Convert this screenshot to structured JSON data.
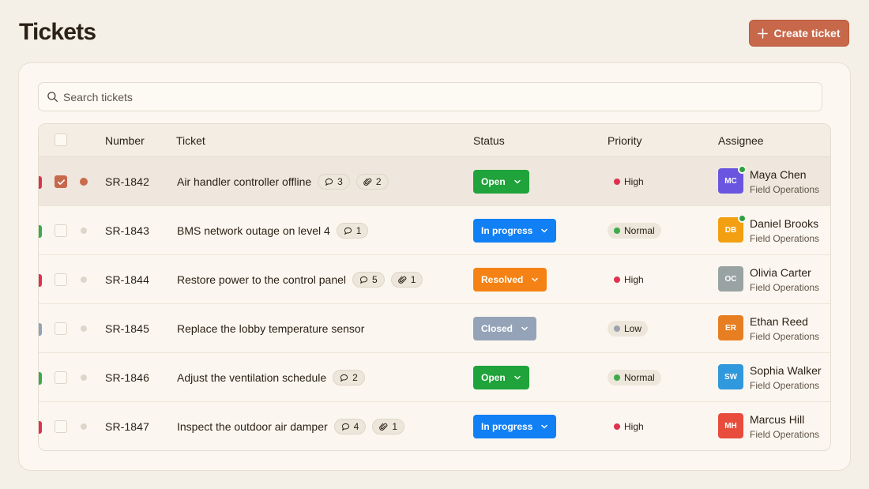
{
  "header": {
    "title": "Tickets",
    "create_label": "Create ticket"
  },
  "search": {
    "placeholder": "Search tickets",
    "value": ""
  },
  "columns": {
    "number": "Number",
    "ticket": "Ticket",
    "status": "Status",
    "priority": "Priority",
    "assignee": "Assignee"
  },
  "colors": {
    "accent": "#c8684a",
    "open": "#1fa33a",
    "in_progress": "#1180f5",
    "resolved": "#f58214",
    "closed": "#94a3b8",
    "high": "#e0314f",
    "normal": "#3dab4a",
    "low": "#9ca3af"
  },
  "rows": [
    {
      "number": "SR-1842",
      "title": "Air handler controller offline",
      "comments": "3",
      "attachments": "2",
      "status": "Open",
      "status_key": "open",
      "priority": "High",
      "priority_key": "high",
      "initials": "MC",
      "avatar_color": "#6a55e0",
      "online": true,
      "assignee": "Maya Chen",
      "team": "Field Operations",
      "stripe": "#e0314f",
      "selected": true,
      "unread": true
    },
    {
      "number": "SR-1843",
      "title": "BMS network outage on level 4",
      "comments": "1",
      "attachments": "",
      "status": "In progress",
      "status_key": "in_progress",
      "priority": "Normal",
      "priority_key": "normal",
      "initials": "DB",
      "avatar_color": "#f29f12",
      "online": true,
      "assignee": "Daniel Brooks",
      "team": "Field Operations",
      "stripe": "#3dab4a",
      "selected": false,
      "unread": false
    },
    {
      "number": "SR-1844",
      "title": "Restore power to the control panel",
      "comments": "5",
      "attachments": "1",
      "status": "Resolved",
      "status_key": "resolved",
      "priority": "High",
      "priority_key": "high",
      "initials": "OC",
      "avatar_color": "#9aa3a3",
      "online": false,
      "assignee": "Olivia Carter",
      "team": "Field Operations",
      "stripe": "#e0314f",
      "selected": false,
      "unread": false
    },
    {
      "number": "SR-1845",
      "title": "Replace the lobby temperature sensor",
      "comments": "",
      "attachments": "",
      "status": "Closed",
      "status_key": "closed",
      "priority": "Low",
      "priority_key": "low",
      "initials": "ER",
      "avatar_color": "#e77e22",
      "online": false,
      "assignee": "Ethan Reed",
      "team": "Field Operations",
      "stripe": "#94a3b8",
      "selected": false,
      "unread": false
    },
    {
      "number": "SR-1846",
      "title": "Adjust the ventilation schedule",
      "comments": "2",
      "attachments": "",
      "status": "Open",
      "status_key": "open",
      "priority": "Normal",
      "priority_key": "normal",
      "initials": "SW",
      "avatar_color": "#3098dc",
      "online": false,
      "assignee": "Sophia Walker",
      "team": "Field Operations",
      "stripe": "#3dab4a",
      "selected": false,
      "unread": false
    },
    {
      "number": "SR-1847",
      "title": "Inspect the outdoor air damper",
      "comments": "4",
      "attachments": "1",
      "status": "In progress",
      "status_key": "in_progress",
      "priority": "High",
      "priority_key": "high",
      "initials": "MH",
      "avatar_color": "#e74c3c",
      "online": false,
      "assignee": "Marcus Hill",
      "team": "Field Operations",
      "stripe": "#e0314f",
      "selected": false,
      "unread": false
    }
  ]
}
